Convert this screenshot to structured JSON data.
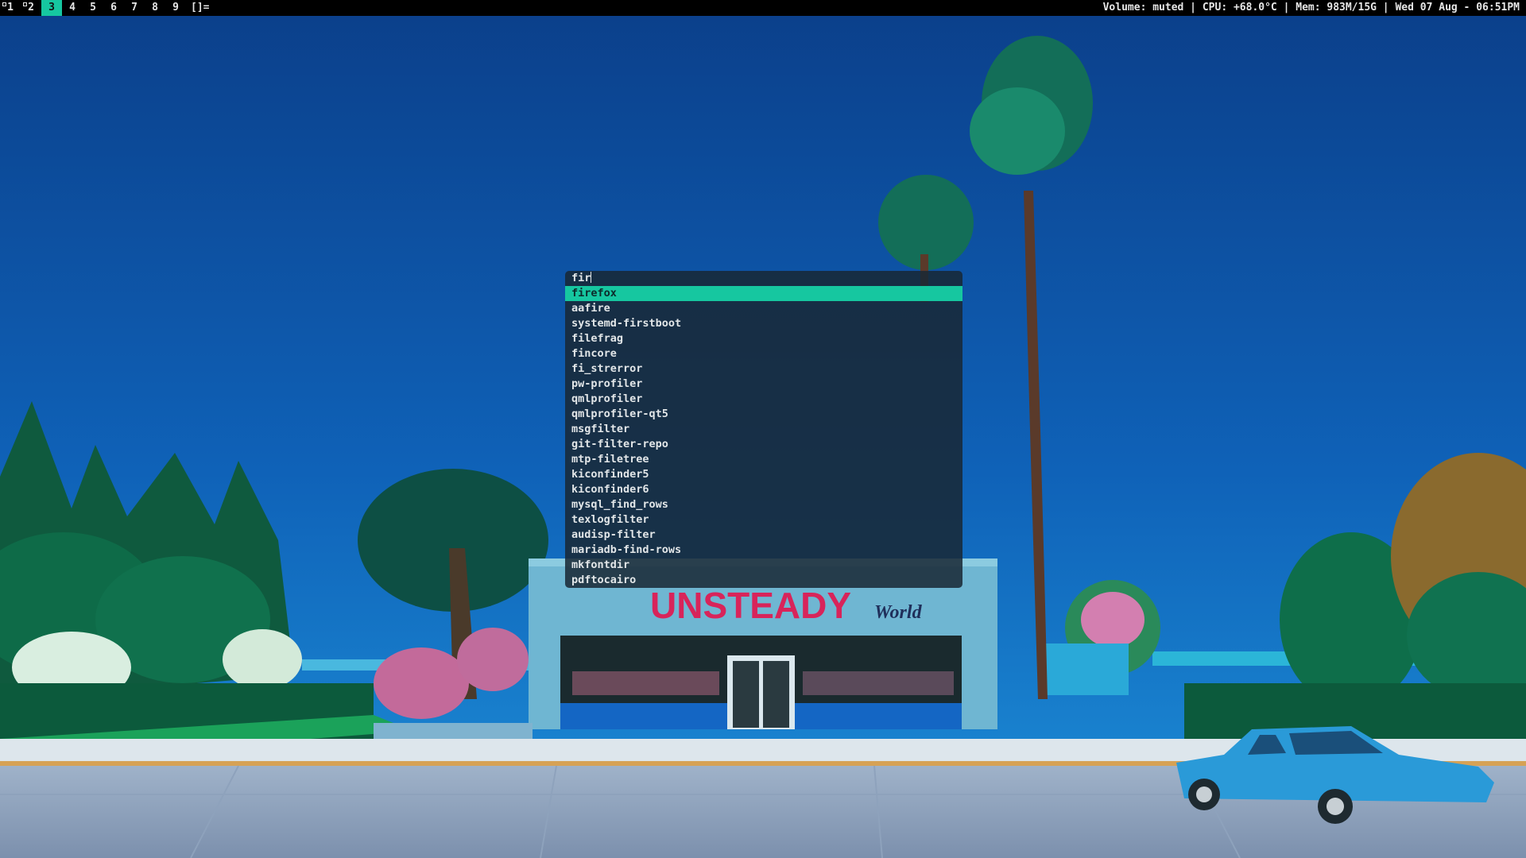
{
  "bar": {
    "tags": [
      {
        "label": "1",
        "occupied": true,
        "active": false
      },
      {
        "label": "2",
        "occupied": true,
        "active": false
      },
      {
        "label": "3",
        "occupied": false,
        "active": true
      },
      {
        "label": "4",
        "occupied": false,
        "active": false
      },
      {
        "label": "5",
        "occupied": false,
        "active": false
      },
      {
        "label": "6",
        "occupied": false,
        "active": false
      },
      {
        "label": "7",
        "occupied": false,
        "active": false
      },
      {
        "label": "8",
        "occupied": false,
        "active": false
      },
      {
        "label": "9",
        "occupied": false,
        "active": false
      }
    ],
    "layout_symbol": "[]=",
    "status": "Volume: muted | CPU: +68.0°C | Mem: 983M/15G | Wed 07 Aug - 06:51PM"
  },
  "launcher": {
    "query": "fir",
    "selected_index": 0,
    "items": [
      "firefox",
      "aafire",
      "systemd-firstboot",
      "filefrag",
      "fincore",
      "fi_strerror",
      "pw-profiler",
      "qmlprofiler",
      "qmlprofiler-qt5",
      "msgfilter",
      "git-filter-repo",
      "mtp-filetree",
      "kiconfinder5",
      "kiconfinder6",
      "mysql_find_rows",
      "texlogfilter",
      "audisp-filter",
      "mariadb-find-rows",
      "mkfontdir",
      "pdftocairo"
    ]
  },
  "wallpaper": {
    "store_sign": "UNSTEADY",
    "store_sign_script": "World",
    "colors": {
      "accent": "#16c7a0",
      "sky_top": "#0b3f8a",
      "sky_bottom": "#1d8fd8",
      "sign": "#d8245a"
    }
  }
}
